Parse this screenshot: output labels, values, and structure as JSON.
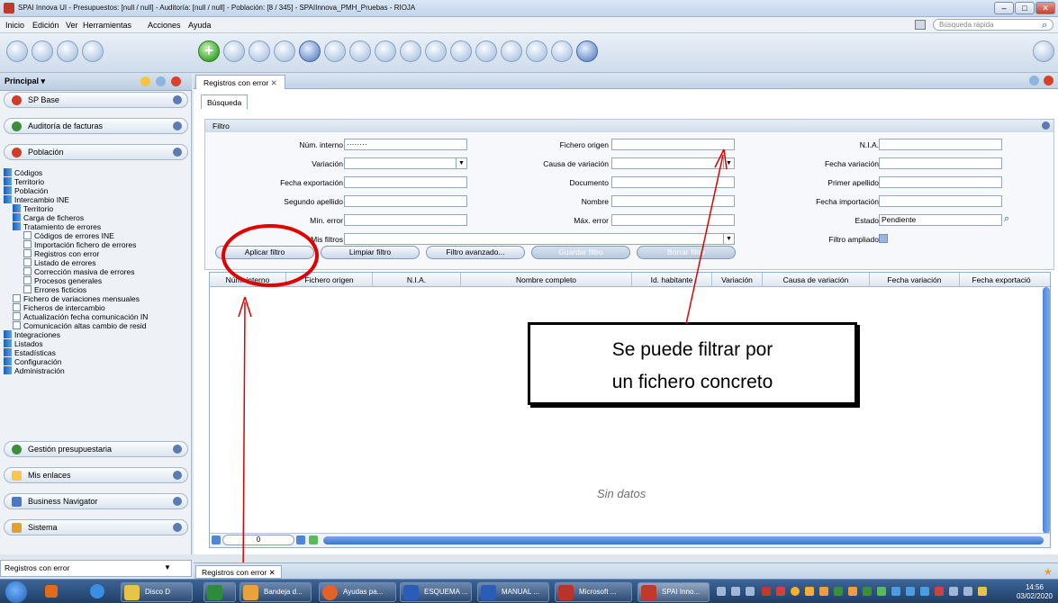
{
  "window": {
    "title": "SPAI Innova UI - Presupuestos: [null / null] - Auditoría: [null / null] - Población: [8 / 345] - SPAIInnova_PMH_Pruebas - RIOJA"
  },
  "menu": {
    "items": [
      "Inicio",
      "Edición",
      "Ver",
      "Herramientas",
      "Acciones",
      "Ayuda"
    ],
    "search_placeholder": "Búsqueda rápida"
  },
  "sidebar": {
    "header": "Principal ▾",
    "sections": {
      "sp_base": "SP Base",
      "auditoria": "Auditoría de facturas",
      "poblacion": "Población",
      "gestion": "Gestión presupuestaria",
      "enlaces": "Mis enlaces",
      "navigator": "Business Navigator",
      "sistema": "Sistema"
    },
    "tree": [
      "Códigos",
      "Territorio",
      "Población",
      "Intercambio INE",
      "Territorio",
      "Carga de ficheros",
      "Tratamiento de errores",
      "Códigos de errores INE",
      "Importación fichero de errores",
      "Registros con error",
      "Listado de errores",
      "Corrección masiva de errores",
      "Procesos generales",
      "Errores ficticios",
      "Fichero de variaciones mensuales",
      "Ficheros de intercambio",
      "Actualización fecha comunicación IN",
      "Comunicación altas cambio de resid",
      "Integraciones",
      "Listados",
      "Estadísticas",
      "Configuración",
      "Administración"
    ],
    "bottom_select": "Registros con error"
  },
  "main": {
    "tab": "Registros con error",
    "subtab": "Búsqueda",
    "filter_title": "Filtro",
    "labels": {
      "num_interno": "Núm. interno",
      "fichero_origen": "Fichero origen",
      "nia": "N.I.A.",
      "variacion": "Variación",
      "causa": "Causa de variación",
      "fecha_variacion": "Fecha variación",
      "fecha_export": "Fecha exportación",
      "documento": "Documento",
      "primer_apellido": "Primer apellido",
      "segundo_apellido": "Segundo apellido",
      "nombre": "Nombre",
      "fecha_import": "Fecha importación",
      "min_error": "Mín. error",
      "max_error": "Máx. error",
      "estado": "Estado",
      "mis_filtros": "Mis filtros",
      "filtro_ampliado": "Filtro ampliado"
    },
    "values": {
      "num_interno": "········",
      "estado": "Pendiente"
    },
    "buttons": {
      "aplicar": "Aplicar filtro",
      "limpiar": "Limpiar filtro",
      "avanzado": "Filtro avanzado...",
      "guardar": "Guardar filtro",
      "borrar": "Borrar filtro"
    },
    "columns": [
      "Núm. interno",
      "Fichero origen",
      "N.I.A.",
      "Nombre completo",
      "Id. habitante",
      "Variación",
      "Causa de variación",
      "Fecha variación",
      "Fecha exportació"
    ],
    "empty_text": "Sin datos",
    "page_number": "0",
    "annotation": "Se puede filtrar por un fichero concreto"
  },
  "bottom_tab": "Registros con error",
  "taskbar": {
    "items": [
      "Disco D",
      "",
      "Bandeja d...",
      "Ayudas pa...",
      "ESQUEMA ...",
      "MANUAL ...",
      "Microsoft ...",
      "SPAI Inno..."
    ],
    "time": "14:56",
    "date": "03/02/2020"
  },
  "colors": {
    "accent": "#3b6fc7",
    "annotation_red": "#e00000"
  }
}
